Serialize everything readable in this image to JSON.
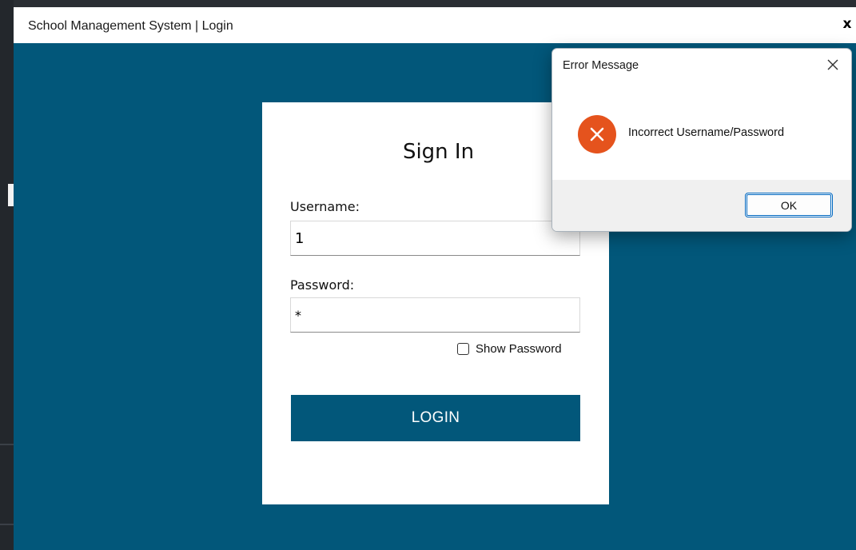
{
  "window": {
    "title": "School Management System | Login",
    "close_label": "x"
  },
  "signin": {
    "heading": "Sign In",
    "username_label": "Username:",
    "username_value": "1",
    "password_label": "Password:",
    "password_value": "*",
    "show_password_label": "Show Password",
    "show_password_checked": false,
    "login_label": "LOGIN"
  },
  "dialog": {
    "title": "Error Message",
    "message": "Incorrect Username/Password",
    "ok_label": "OK",
    "icon": "error-x-icon"
  },
  "colors": {
    "app_background": "#02577a",
    "error_icon": "#e5531d",
    "dialog_footer": "#f0f0f0",
    "ok_border": "#0067c0"
  }
}
